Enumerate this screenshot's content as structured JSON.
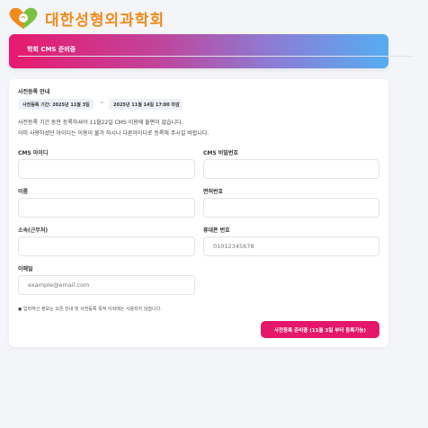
{
  "brand": {
    "logo_text": "대한성형외과학회"
  },
  "banner": {
    "title": "학회 CMS 준비중"
  },
  "notice": {
    "title": "사전등록 안내",
    "period_label": "사전등록 기간: 2025년 11월 3일",
    "separator": "~",
    "period_end": "2025년 11월 14일 17:00 마감",
    "line1": "사전등록 기간 동안 등록하셔야 11월22일 CMS 이용에 불편이 없습니다.",
    "line2": "이미 사용하셨던 아이디는 이용이 불가 하시니 다른아이디로 등록해 주시길 바랍니다."
  },
  "form": {
    "cms_id_label": "CMS 아이디",
    "cms_pw_label": "CMS 비밀번호",
    "name_label": "이름",
    "license_label": "면허번호",
    "affiliation_label": "소속(근무처)",
    "phone_label": "휴대폰 번호",
    "phone_placeholder": "01012345678",
    "email_label": "이메일",
    "email_placeholder": "example@email.com",
    "footnote": "● 입력하신 정보는 오픈 안내 및 사전등록 목적 이외에는 사용되지 않습니다.",
    "submit_label": "사전등록 준비중 (11월 3일 부터 등록가능)"
  },
  "colors": {
    "brand_orange": "#f08a1c",
    "accent_pink": "#e5176a",
    "gradient_start": "#e8196e",
    "gradient_end": "#56adf2"
  }
}
